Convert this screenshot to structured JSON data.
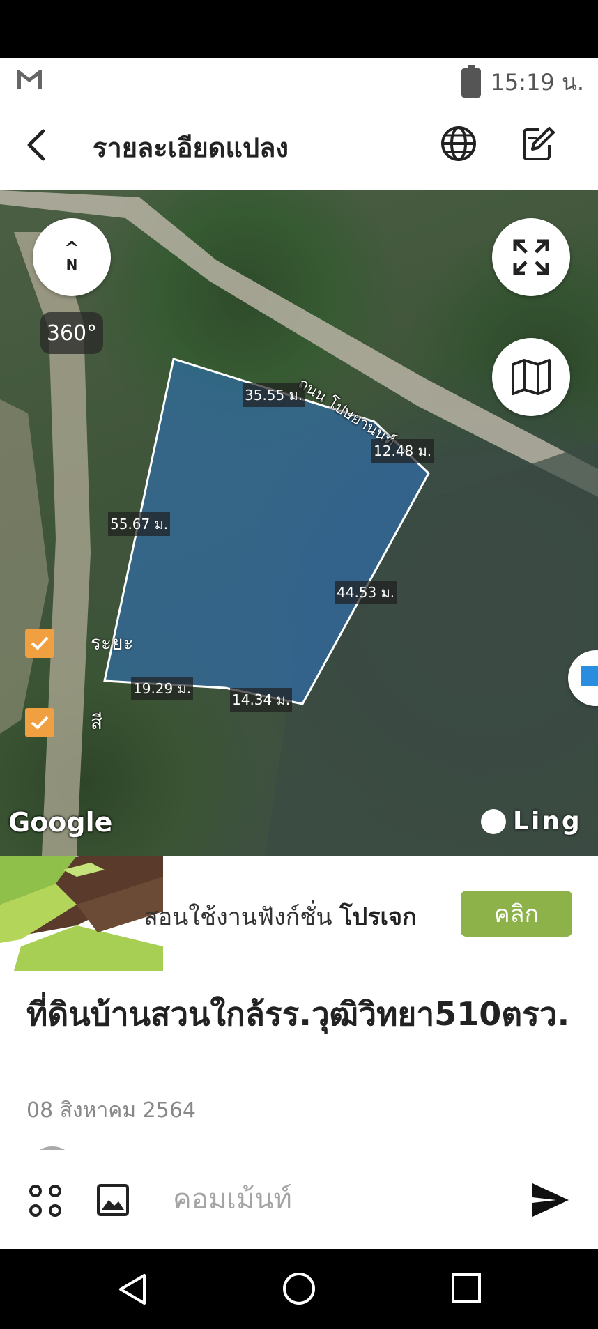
{
  "status_bar": {
    "time": "15:19 น.",
    "mail_icon": "gmail-icon",
    "battery_icon": "battery-charging-icon"
  },
  "app_bar": {
    "title": "รายละเอียดแปลง",
    "back_icon": "back-arrow-icon",
    "globe_icon": "globe-icon",
    "edit_icon": "edit-icon"
  },
  "map": {
    "compass_label": "N",
    "compass_arrow": "^",
    "view_360_label": "360°",
    "road_name": "ถนน โปษยานนท์",
    "dimensions": {
      "top": "35.55 ม.",
      "top_right": "12.48 ม.",
      "left": "55.67 ม.",
      "right": "44.53 ม.",
      "bottom_left": "19.29 ม.",
      "bottom": "14.34 ม."
    },
    "toggles": [
      {
        "label": "ระยะ",
        "checked": true
      },
      {
        "label": "สี",
        "checked": true
      }
    ],
    "google_logo": "Google",
    "ling_logo": "Ling",
    "plot_color": "#2f6fb0"
  },
  "banner": {
    "text_regular": "สอนใช้งานฟังก์ชั่น ",
    "text_bold": "โปรเจก",
    "button_label": "คลิก",
    "button_color": "#8db24a"
  },
  "post": {
    "title": "ที่ดินบ้านสวนใกล้รร.วุฒิวิทยา510ตรว.",
    "date": "08 สิงหาคม 2564"
  },
  "comment_bar": {
    "placeholder": "คอมเม้นท์",
    "apps_icon": "apps-grid-icon",
    "image_icon": "image-icon",
    "send_icon": "send-icon"
  },
  "nav_bar": {
    "back_icon": "nav-back-icon",
    "home_icon": "nav-home-icon",
    "recent_icon": "nav-recent-icon"
  }
}
